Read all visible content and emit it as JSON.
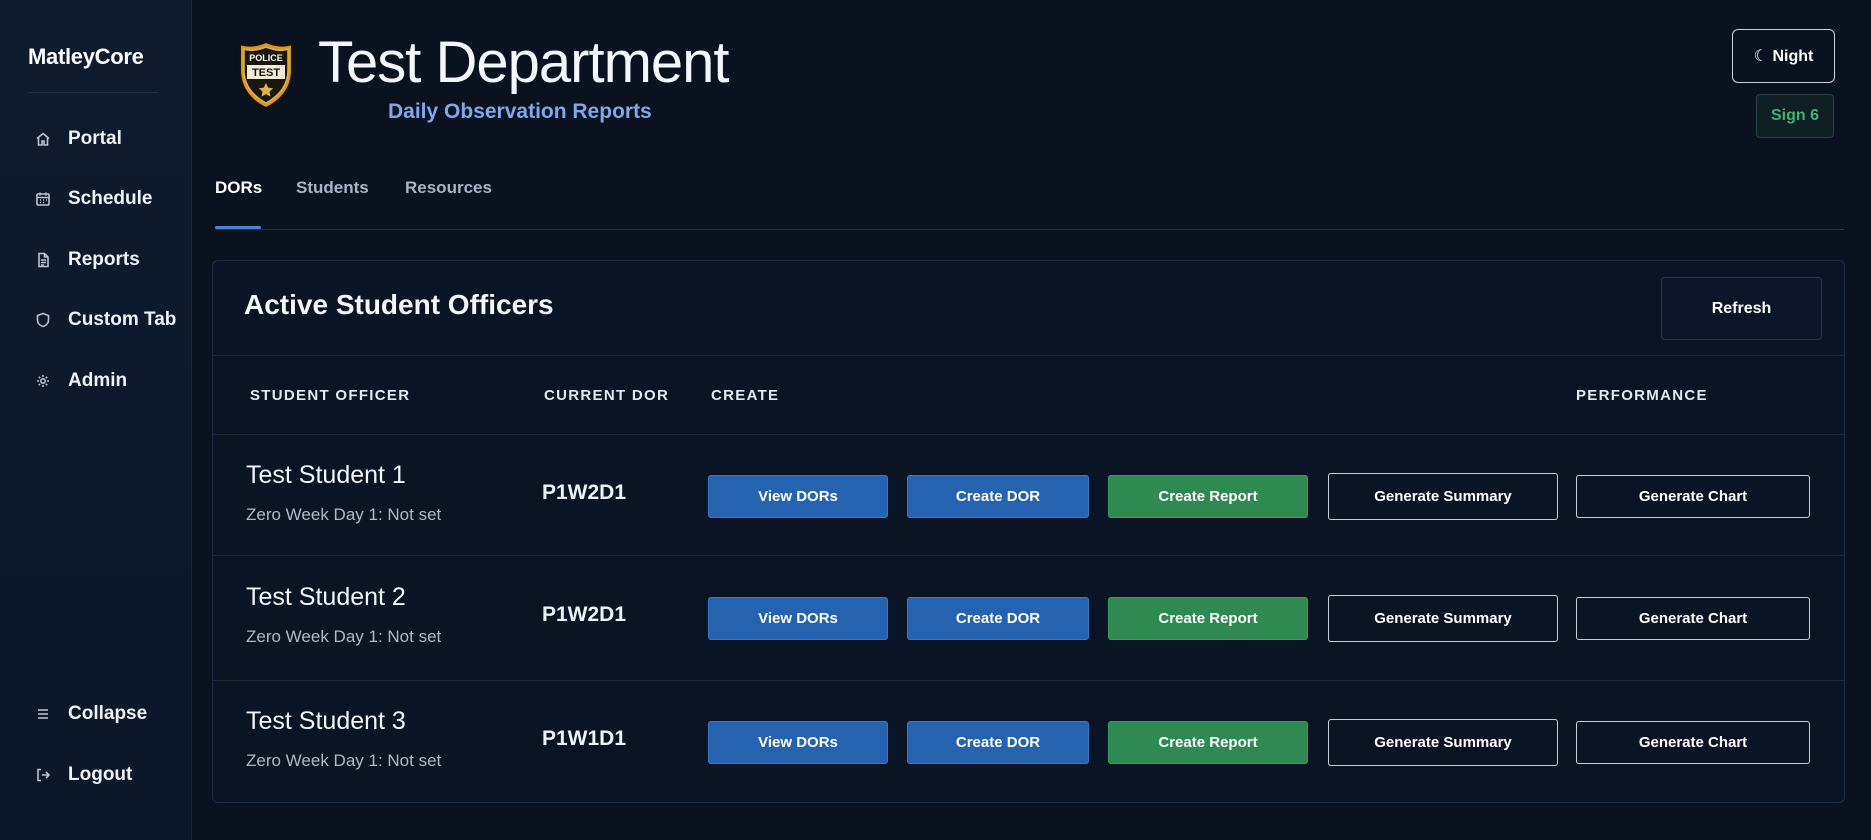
{
  "sidebar": {
    "brand": "MatleyCore",
    "items": [
      {
        "label": "Portal",
        "icon": "home-icon"
      },
      {
        "label": "Schedule",
        "icon": "calendar-icon"
      },
      {
        "label": "Reports",
        "icon": "document-icon"
      },
      {
        "label": "Custom Tab",
        "icon": "shield-icon"
      },
      {
        "label": "Admin",
        "icon": "gear-icon"
      }
    ],
    "collapse_label": "Collapse",
    "logout_label": "Logout"
  },
  "header": {
    "badge_top": "POLICE",
    "badge_bottom": "TEST",
    "title": "Test Department",
    "subtitle": "Daily Observation Reports",
    "night_label": "☾ Night",
    "sign_label": "Sign 6"
  },
  "tabs": [
    {
      "label": "DORs",
      "active": true
    },
    {
      "label": "Students",
      "active": false
    },
    {
      "label": "Resources",
      "active": false
    }
  ],
  "card": {
    "title": "Active Student Officers",
    "refresh_label": "Refresh",
    "columns": {
      "student": "STUDENT OFFICER",
      "current_dor": "CURRENT DOR",
      "create": "CREATE",
      "performance": "PERFORMANCE"
    },
    "actions": {
      "view": "View DORs",
      "create_dor": "Create DOR",
      "create_report": "Create Report",
      "summary": "Generate Summary",
      "chart": "Generate Chart"
    },
    "rows": [
      {
        "name": "Test Student 1",
        "sub": "Zero Week Day 1: Not set",
        "dor": "P1W2D1"
      },
      {
        "name": "Test Student 2",
        "sub": "Zero Week Day 1: Not set",
        "dor": "P1W2D1"
      },
      {
        "name": "Test Student 3",
        "sub": "Zero Week Day 1: Not set",
        "dor": "P1W1D1"
      }
    ]
  },
  "colors": {
    "accent_blue": "#2563b0",
    "accent_green": "#2f8a52",
    "subtitle_blue": "#7fa8e6",
    "sign_green": "#3fb373"
  }
}
